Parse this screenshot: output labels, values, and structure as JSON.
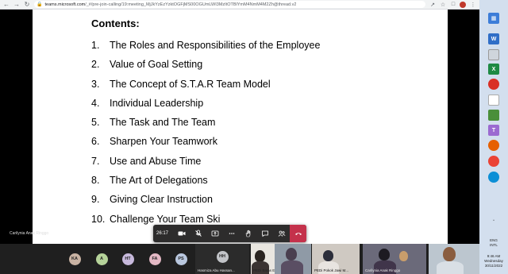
{
  "browser": {
    "url_domain": "teams.microsoft.com",
    "url_path": "/_#/pre-join-calling/19:meeting_MjJkYzEzYzktOGFjMS00OGUmLWI3MzItOTBlYmM4NmM4M2Zh@thread.v2"
  },
  "slide": {
    "title": "Contents:",
    "items": [
      {
        "num": "1.",
        "text": "The Roles and Responsibilities  of the Employee"
      },
      {
        "num": "2.",
        "text": "Value of Goal Setting"
      },
      {
        "num": "3.",
        "text": "The Concept of S.T.A.R Team Model"
      },
      {
        "num": "4.",
        "text": "Individual Leadership"
      },
      {
        "num": "5.",
        "text": "The Task and The Team"
      },
      {
        "num": "6.",
        "text": "Sharpen Your Teamwork"
      },
      {
        "num": "7.",
        "text": "Use and Abuse Time"
      },
      {
        "num": "8.",
        "text": "The Art of Delegations"
      },
      {
        "num": "9.",
        "text": "Giving Clear Instruction"
      },
      {
        "num": "10.",
        "text": "Challenge Your Team Ski"
      }
    ]
  },
  "presenter_label": "Carilynia Anak Ringgo",
  "meeting": {
    "timer": "26:17"
  },
  "participants": [
    {
      "initials": "KA",
      "color": "#c9b3a3"
    },
    {
      "initials": "A",
      "color": "#b6d39a"
    },
    {
      "initials": "HT",
      "color": "#c7b9dc"
    },
    {
      "initials": "FA",
      "color": "#e3b8c4"
    },
    {
      "initials": "PS",
      "color": "#b9c7de"
    },
    {
      "initials": "HH",
      "color": "#c2c4c8",
      "name": "Hasmiza Abu Hassan..."
    }
  ],
  "video_participants": [
    {
      "name": "PEDi Batas Endang -..."
    },
    {
      "name": ""
    },
    {
      "name": "PEDi Pokok Jawi M..."
    },
    {
      "name": "Carilynia Anak Ringgo"
    },
    {
      "name": ""
    }
  ],
  "taskbar": {
    "lang": "ENG",
    "region": "INTL",
    "time": "9:46 AM",
    "day": "Wednesday",
    "date": "30/11/2022"
  }
}
